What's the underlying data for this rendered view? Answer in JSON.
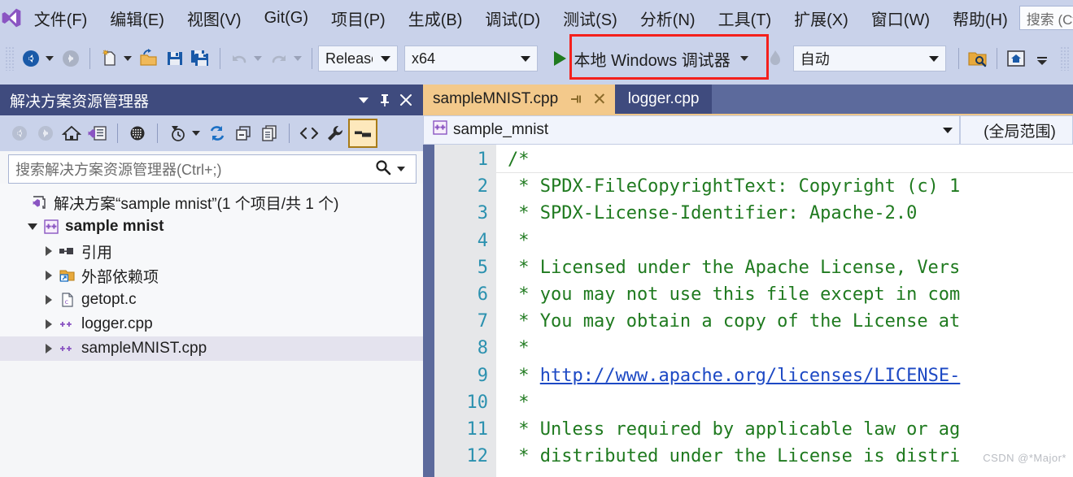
{
  "app": {
    "logo_icon": "visual-studio-logo",
    "search_placeholder": "搜索 (Ctrl+Q)"
  },
  "menubar": {
    "items": [
      {
        "label": "文件(F)"
      },
      {
        "label": "编辑(E)"
      },
      {
        "label": "视图(V)"
      },
      {
        "label": "Git(G)"
      },
      {
        "label": "项目(P)"
      },
      {
        "label": "生成(B)"
      },
      {
        "label": "调试(D)"
      },
      {
        "label": "测试(S)"
      },
      {
        "label": "分析(N)"
      },
      {
        "label": "工具(T)"
      },
      {
        "label": "扩展(X)"
      },
      {
        "label": "窗口(W)"
      },
      {
        "label": "帮助(H)"
      }
    ]
  },
  "toolbar": {
    "configuration": "Release",
    "platform": "x64",
    "debug_target": "本地 Windows 调试器",
    "attach_target": "自动",
    "icons": [
      "navigate-back-icon",
      "navigate-forward-icon",
      "new-file-icon",
      "open-file-icon",
      "save-icon",
      "save-all-icon",
      "undo-icon",
      "redo-icon",
      "hot-reload-icon",
      "find-in-files-icon",
      "start-page-icon",
      "overflow-icon"
    ]
  },
  "solution_explorer": {
    "title": "解决方案资源管理器",
    "search_placeholder": "搜索解决方案资源管理器(Ctrl+;)",
    "toolbar_icons": [
      "back-icon",
      "forward-icon",
      "home-icon",
      "solution-icon",
      "pending-changes-icon",
      "history-icon",
      "refresh-icon",
      "collapse-all-icon",
      "show-all-files-icon",
      "view-code-icon",
      "properties-icon",
      "preview-selected-items-icon"
    ],
    "tree": [
      {
        "label": "解决方案“sample mnist”(1 个项目/共 1 个)",
        "icon": "solution-icon",
        "depth": 0,
        "expander": "none",
        "bold": false,
        "selected": false
      },
      {
        "label": "sample mnist",
        "icon": "cpp-project-icon",
        "depth": 1,
        "expander": "down",
        "bold": true,
        "selected": false
      },
      {
        "label": "引用",
        "icon": "references-icon",
        "depth": 2,
        "expander": "right",
        "bold": false,
        "selected": false
      },
      {
        "label": "外部依赖项",
        "icon": "external-dependencies-icon",
        "depth": 2,
        "expander": "right",
        "bold": false,
        "selected": false
      },
      {
        "label": "getopt.c",
        "icon": "c-file-icon",
        "depth": 2,
        "expander": "right",
        "bold": false,
        "selected": false
      },
      {
        "label": "logger.cpp",
        "icon": "cpp-file-icon",
        "depth": 2,
        "expander": "right",
        "bold": false,
        "selected": false
      },
      {
        "label": "sampleMNIST.cpp",
        "icon": "cpp-file-icon",
        "depth": 2,
        "expander": "right",
        "bold": false,
        "selected": true
      }
    ]
  },
  "editor": {
    "tabs": [
      {
        "label": "sampleMNIST.cpp",
        "active": true
      },
      {
        "label": "logger.cpp",
        "active": false
      }
    ],
    "nav_project": "sample_mnist",
    "nav_scope": "(全局范围)",
    "lines": [
      {
        "number": "1",
        "text": "/*",
        "link": null,
        "current": true
      },
      {
        "number": "2",
        "text": " * SPDX-FileCopyrightText: Copyright (c) 1",
        "link": null,
        "current": false
      },
      {
        "number": "3",
        "text": " * SPDX-License-Identifier: Apache-2.0",
        "link": null,
        "current": false
      },
      {
        "number": "4",
        "text": " *",
        "link": null,
        "current": false
      },
      {
        "number": "5",
        "text": " * Licensed under the Apache License, Vers",
        "link": null,
        "current": false
      },
      {
        "number": "6",
        "text": " * you may not use this file except in com",
        "link": null,
        "current": false
      },
      {
        "number": "7",
        "text": " * You may obtain a copy of the License at",
        "link": null,
        "current": false
      },
      {
        "number": "8",
        "text": " *",
        "link": null,
        "current": false
      },
      {
        "number": "9",
        "text": " * ",
        "link": "http://www.apache.org/licenses/LICENSE-",
        "current": false
      },
      {
        "number": "10",
        "text": " *",
        "link": null,
        "current": false
      },
      {
        "number": "11",
        "text": " * Unless required by applicable law or ag",
        "link": null,
        "current": false
      },
      {
        "number": "12",
        "text": " * distributed under the License is distri",
        "link": null,
        "current": false
      }
    ],
    "watermark": "CSDN @*Major*"
  },
  "colors": {
    "chrome": "#c9d2ea",
    "title_active": "#3f4b7e",
    "tab_active": "#f3c98b",
    "editor_frame": "#5c6a9c",
    "comment_green": "#1f7a1f",
    "link_blue": "#1d49c4",
    "line_number": "#2b91af",
    "highlight_red": "#f4201c",
    "logo_purple": "#8a55c2"
  }
}
